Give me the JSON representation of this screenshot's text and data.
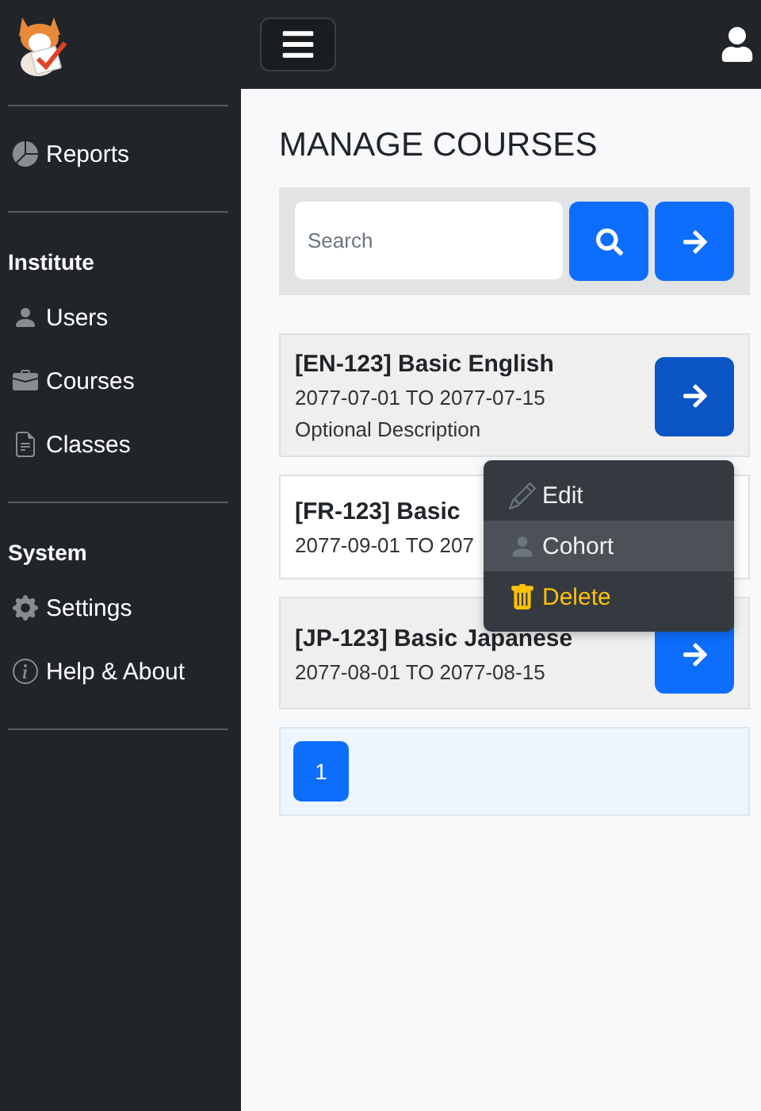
{
  "sidebar": {
    "groups": [
      {
        "items": [
          {
            "label": "Reports"
          }
        ]
      },
      {
        "title": "Institute",
        "items": [
          {
            "label": "Users"
          },
          {
            "label": "Courses"
          },
          {
            "label": "Classes"
          }
        ]
      },
      {
        "title": "System",
        "items": [
          {
            "label": "Settings"
          },
          {
            "label": "Help & About"
          }
        ]
      }
    ]
  },
  "page": {
    "title": "MANAGE COURSES"
  },
  "search": {
    "placeholder": "Search"
  },
  "courses": [
    {
      "title": "[EN-123] Basic English",
      "dates": "2077-07-01 TO 2077-07-15",
      "description": "Optional Description",
      "show_button": true,
      "active": true
    },
    {
      "title": "[FR-123] Basic",
      "dates": "2077-09-01 TO 207",
      "show_button": false
    },
    {
      "title": "[JP-123] Basic Japanese",
      "dates": "2077-08-01 TO 2077-08-15",
      "show_button": true,
      "active": false
    }
  ],
  "menu": {
    "items": [
      {
        "label": "Edit",
        "kind": "normal",
        "selected": false
      },
      {
        "label": "Cohort",
        "kind": "normal",
        "selected": true
      },
      {
        "label": "Delete",
        "kind": "danger",
        "selected": false
      }
    ]
  },
  "pagination": {
    "pages": [
      {
        "label": "1",
        "selected": true
      }
    ]
  }
}
